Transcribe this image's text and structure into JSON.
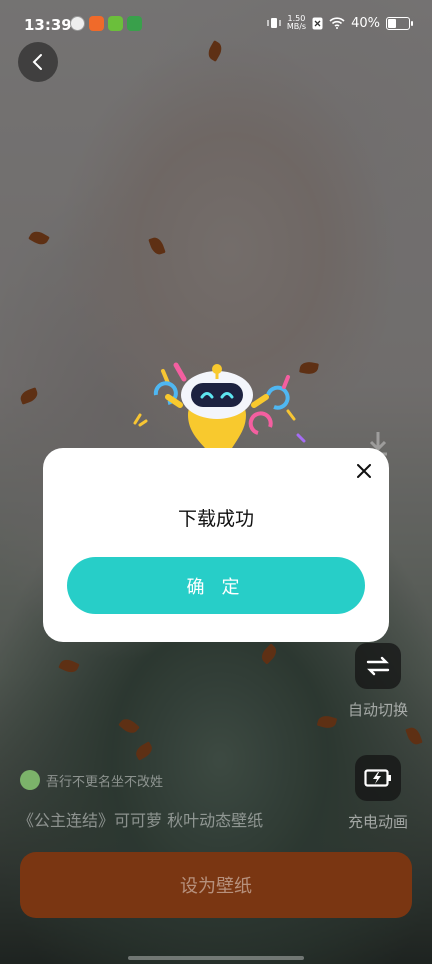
{
  "status_bar": {
    "time": "13:39",
    "net_speed_value": "1.50",
    "net_speed_unit": "MB/s",
    "battery": "40%",
    "battery_level": 0.4
  },
  "side_controls": {
    "auto_switch_label": "自动切换",
    "charge_anim_label": "充电动画"
  },
  "wallpaper": {
    "author": "吾行不更名坐不改姓",
    "title": "《公主连结》可可萝    秋叶动态壁纸"
  },
  "set_wallpaper_label": "设为壁纸",
  "dialog": {
    "message": "下载成功",
    "confirm_label": "确 定"
  },
  "colors": {
    "accent": "#27cec8",
    "set_button": "#7a3612"
  }
}
